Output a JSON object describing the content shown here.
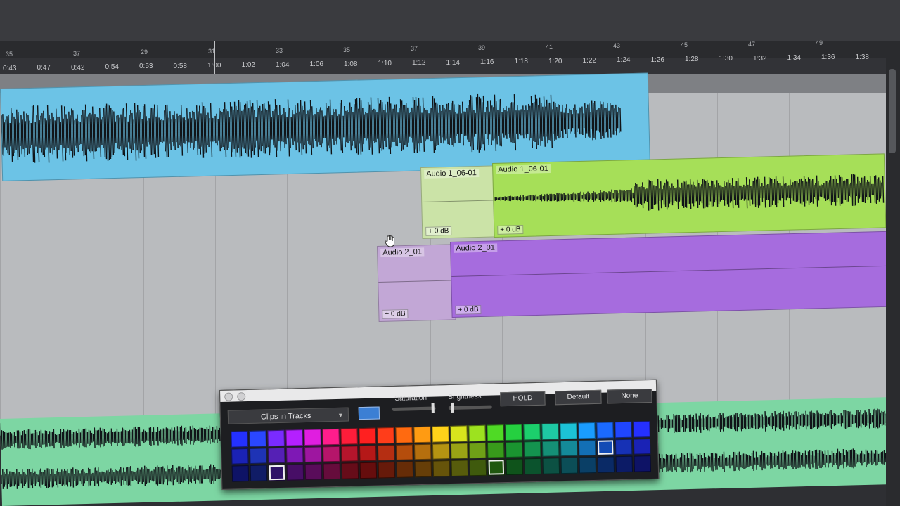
{
  "ruler": {
    "bars": [
      "35",
      "37",
      "29",
      "31",
      "33",
      "35",
      "37",
      "39",
      "41",
      "43",
      "45",
      "47",
      "49"
    ],
    "times": [
      "0:43",
      "0:47",
      "0:42",
      "0:54",
      "0:53",
      "0:58",
      "1:00",
      "1:02",
      "1:04",
      "1:06",
      "1:08",
      "1:10",
      "1:12",
      "1:14",
      "1:16",
      "1:18",
      "1:20",
      "1:22",
      "1:24",
      "1:26",
      "1:28",
      "1:30",
      "1:32",
      "1:34",
      "1:36",
      "1:38"
    ]
  },
  "clips": {
    "blue_main": {
      "title": "",
      "color": "#6cc3e6"
    },
    "green_faded": {
      "title": "Audio 1_06-01",
      "gain": "+ 0 dB",
      "color": "#cbe3a7"
    },
    "green_main": {
      "title": "Audio 1_06-01",
      "gain": "+ 0 dB",
      "color": "#a6df58"
    },
    "purple_faded": {
      "title": "Audio 2_01",
      "gain": "+ 0 dB",
      "color": "#c2a7d6"
    },
    "purple_main": {
      "title": "Audio 2_01",
      "gain": "+ 0 dB",
      "color": "#a66cde"
    }
  },
  "palette": {
    "dropdown_label": "Clips in Tracks",
    "saturation_label": "Saturation",
    "brightness_label": "Brightness",
    "hold_label": "HOLD",
    "default_label": "Default",
    "none_label": "None",
    "rows": [
      [
        "#2431ff",
        "#2a47ff",
        "#7a2bff",
        "#b420ff",
        "#e01ee0",
        "#ff1d8c",
        "#ff1d3a",
        "#ff2020",
        "#ff3d1a",
        "#ff6a10",
        "#ff9b12",
        "#ffd21a",
        "#d8e41d",
        "#9de21f",
        "#4fda25",
        "#25d040",
        "#1ccf6c",
        "#1ec9a3",
        "#1cc2d6",
        "#1a9cff",
        "#1b6aff",
        "#2046ff",
        "#2530ff"
      ],
      [
        "#1a22b5",
        "#1e33b5",
        "#5520b5",
        "#7e18b5",
        "#9e16a0",
        "#b5156a",
        "#b5152c",
        "#b51818",
        "#b52e12",
        "#b54d0c",
        "#b56f0e",
        "#b59412",
        "#9aa315",
        "#6fa017",
        "#389a1b",
        "#1a9430",
        "#14934f",
        "#158f76",
        "#148a99",
        "#136fb5",
        "#134bb5",
        "#1631b5",
        "#1a22b5"
      ],
      [
        "#0e1366",
        "#101c66",
        "#2f1266",
        "#470e66",
        "#590c5a",
        "#660c3c",
        "#660c19",
        "#660d0d",
        "#661a0a",
        "#662c07",
        "#663e08",
        "#66540a",
        "#575c0c",
        "#3f5a0d",
        "#20570f",
        "#0f531b",
        "#0b532d",
        "#0c5143",
        "#0b4e57",
        "#0a3f66",
        "#0a2a66",
        "#0c1b66",
        "#0e1366"
      ]
    ],
    "selected": [
      [
        2,
        2
      ],
      [
        2,
        14
      ],
      [
        1,
        20
      ]
    ]
  }
}
